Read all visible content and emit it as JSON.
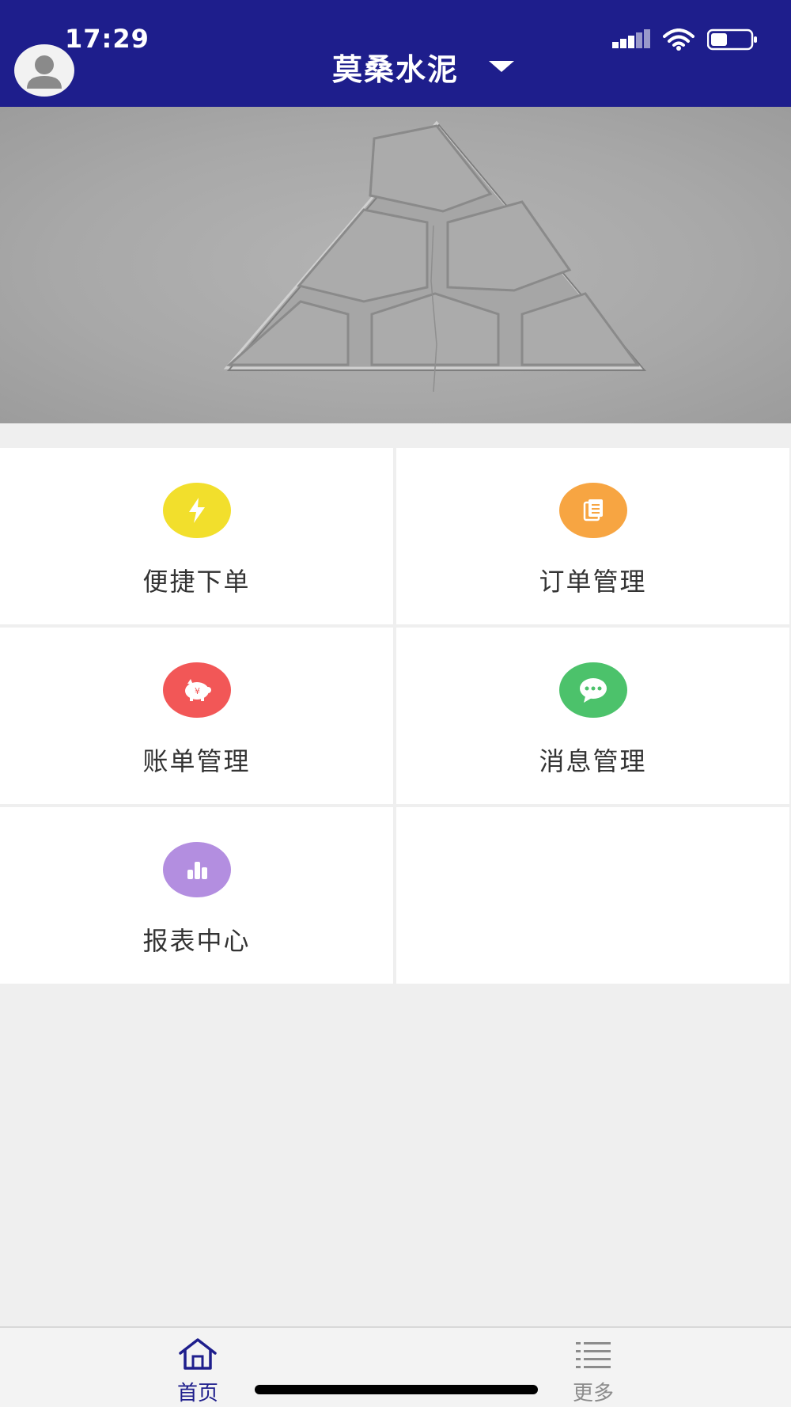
{
  "status_bar": {
    "time": "17:29"
  },
  "header": {
    "title": "莫桑水泥"
  },
  "menu": {
    "items": [
      {
        "label": "便捷下单",
        "icon": "lightning-icon",
        "color": "#f2df2c"
      },
      {
        "label": "订单管理",
        "icon": "document-icon",
        "color": "#f7a542"
      },
      {
        "label": "账单管理",
        "icon": "piggy-bank-icon",
        "color": "#f25757"
      },
      {
        "label": "消息管理",
        "icon": "chat-bubble-icon",
        "color": "#4cc26b"
      },
      {
        "label": "报表中心",
        "icon": "bar-chart-icon",
        "color": "#b38ee0"
      }
    ]
  },
  "tabbar": {
    "tabs": [
      {
        "label": "首页",
        "icon": "home-icon",
        "active": true
      },
      {
        "label": "更多",
        "icon": "list-icon",
        "active": false
      }
    ]
  },
  "colors": {
    "header": "#1e1e8c",
    "tab_active": "#1e1e8c",
    "tab_inactive": "#8c8c8c"
  }
}
